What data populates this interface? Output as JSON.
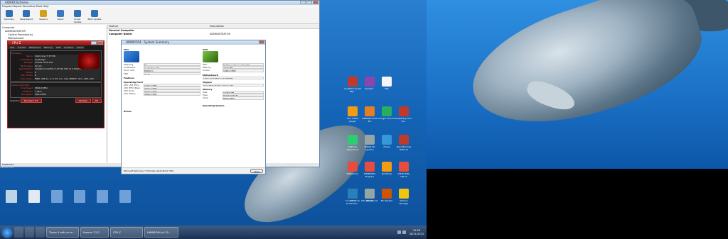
{
  "aida": {
    "title": "AIDA64 Extreme",
    "menu": "Program  Report  Favourites  Tools  Help",
    "tools": [
      "Summary",
      "Save Report",
      "Sensors",
      "About",
      "Driver Update",
      "BIOS Update"
    ],
    "tree": [
      "Computer",
      "ADMINISTRATOR",
      "Central Processor(s)",
      "Motherboard",
      "Memory"
    ],
    "col_feature": "Feature",
    "col_description": "Description",
    "rows": [
      {
        "k": "General Computer",
        "v": ""
      },
      {
        "k": "Computer Name:",
        "v": "ADMINISTRATOR"
      }
    ],
    "status": "HWINFO64"
  },
  "cpuz": {
    "title": "CPU-Z",
    "tabs": [
      "CPU",
      "Caches",
      "Mainboard",
      "Memory",
      "SPD",
      "Graphics",
      "About"
    ],
    "processor_label": "Processor",
    "rows": [
      {
        "k": "Name",
        "v": "Intel Core i7 3770K"
      },
      {
        "k": "Code Name",
        "v": "Ivy Bridge"
      },
      {
        "k": "Package",
        "v": "Socket 1155 LGA"
      },
      {
        "k": "Technology",
        "v": "22 nm"
      },
      {
        "k": "Specification",
        "v": "Intel(R) Core(TM) i7-3770K CPU @ 3.50GHz"
      },
      {
        "k": "Family",
        "v": "6"
      },
      {
        "k": "Ext. Family",
        "v": "6"
      },
      {
        "k": "Instructions",
        "v": "MMX, SSE (1, 2, 3, 3S, 4.1, 4.2), EM64T, VT-x, AES, AVX"
      }
    ],
    "clocks_label": "Clocks (Core #0)",
    "clocks": [
      {
        "k": "Core Speed",
        "v": "3600.0 MHz"
      },
      {
        "k": "Multiplier",
        "v": "x 36.0"
      },
      {
        "k": "Bus Speed",
        "v": "100.0 MHz"
      }
    ],
    "selection_label": "Selection",
    "selection_value": "Processor #1",
    "validate": "Validate",
    "ok": "OK"
  },
  "hw": {
    "title": "HWiNFO64 - System Summary",
    "cpu_label": "CPU",
    "gpu_label": "GPU",
    "cpu_rows": [
      {
        "k": "Stepping",
        "v": "E1"
      },
      {
        "k": "Codename",
        "v": "Ivy Bridge-DT"
      },
      {
        "k": "Prod. Unit",
        "v": "Platform"
      },
      {
        "k": "TDP",
        "v": "77 W"
      }
    ],
    "features_label": "Features",
    "operating_label": "Operating Point",
    "op_rows": [
      {
        "k": "CPU LFM (Min)",
        "v": "1600.0 MHz"
      },
      {
        "k": "CPU HFM (Max)",
        "v": "3500.0 MHz"
      },
      {
        "k": "CPU Turbo",
        "v": "3900.0 MHz"
      },
      {
        "k": "CPU Status",
        "v": "3600.0 MHz"
      }
    ],
    "gpu_rows": [
      {
        "k": "GPU",
        "v": "NVIDIA GeForce GTX 770"
      },
      {
        "k": "Memory",
        "v": "2048 MB"
      },
      {
        "k": "Clocks",
        "v": "1084.0 MHz"
      }
    ],
    "mobo_label": "Motherboard",
    "mobo_value": "ASUS MAXIMUS V EXTREME",
    "chipset_label": "Chipset",
    "chipset_value": "Intel Z77 (Panther Point-DH)",
    "memory_label": "Memory",
    "memory_rows": [
      {
        "k": "Size",
        "v": "16384 MB"
      },
      {
        "k": "Type",
        "v": "DDR3 SDRAM"
      },
      {
        "k": "Clock",
        "v": "800.0 MHz"
      }
    ],
    "drives_label": "Drives",
    "os_label": "Operating System",
    "os_value": "Microsoft Windows 7 Ultimate (x64) Build 7601",
    "close": "Close"
  },
  "desktop": {
    "right_icons": [
      {
        "label": "Asustek's Crash Rep...",
        "color": "#c0392b"
      },
      {
        "label": "AsusAO...",
        "color": "#8e44ad"
      },
      {
        "label": "Talk",
        "color": "#f5f5f5"
      },
      {
        "label": "VLC media player",
        "color": "#f39c12"
      },
      {
        "label": "CINEMAX Tools Pro",
        "color": "#e67e22"
      },
      {
        "label": "Google Chrome",
        "color": "#27ae60"
      },
      {
        "label": "Kaspersky Anti-Vir...",
        "color": "#c0392b"
      },
      {
        "label": "GeForce Experience",
        "color": "#2ecc71"
      },
      {
        "label": "TeStall 3D Ignition",
        "color": "#95a5a6"
      },
      {
        "label": "iTunes",
        "color": "#3498db"
      },
      {
        "label": "Nero Burning ROM 12",
        "color": "#c0392b"
      },
      {
        "label": "MSIMonitor",
        "color": "#e74c3c"
      },
      {
        "label": "HWINFO64 Program",
        "color": "#e74c3c"
      },
      {
        "label": "RaidTools",
        "color": "#f39c12"
      },
      {
        "label": "CPUID ROG CPU-Z",
        "color": "#e74c3c"
      },
      {
        "label": "MSI Kombusto...",
        "color": "#bdc3c7"
      },
      {
        "label": "UltraIS",
        "color": "#7f8c8d"
      },
      {
        "label": "BC TweakS",
        "color": "#d35400"
      },
      {
        "label": "STAAnn Manager",
        "color": "#f1c40f"
      },
      {
        "label": "Control Panel",
        "color": "#2980b9"
      },
      {
        "label": "MSI Afterburner",
        "color": "#95a5a6"
      }
    ],
    "left_icons": [
      {
        "label": "",
        "kind": "trash"
      },
      {
        "label": "",
        "kind": "cr"
      },
      {
        "label": "",
        "kind": "f"
      },
      {
        "label": "",
        "kind": "f"
      },
      {
        "label": "",
        "kind": "f"
      },
      {
        "label": "",
        "kind": "f"
      }
    ],
    "ghost_label": "HWINFO64"
  },
  "taskbar": {
    "tasks": [
      "Tlaver 4 cells on m...",
      "Hmmm 7.5.2",
      "CPU-Z",
      "HWiNFO64 v4.20..."
    ],
    "time": "15:56",
    "date": "28/11/2013"
  }
}
